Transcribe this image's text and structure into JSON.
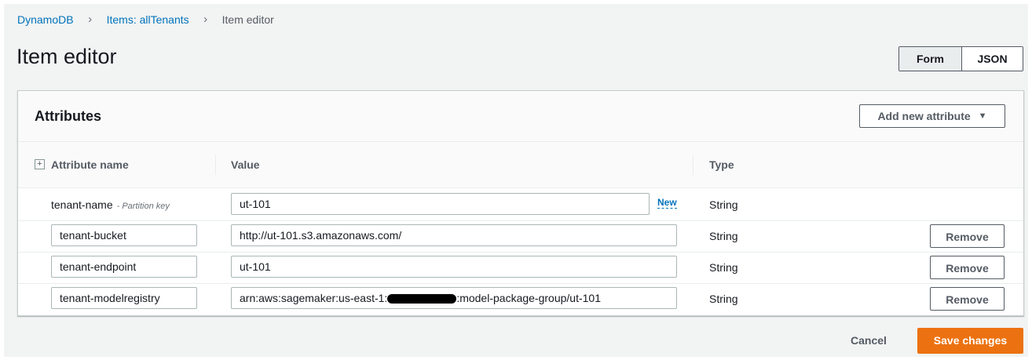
{
  "breadcrumb": {
    "items": [
      "DynamoDB",
      "Items: allTenants"
    ],
    "current": "Item editor",
    "separator": ">"
  },
  "page_title": "Item editor",
  "mode_toggle": {
    "form_label": "Form",
    "json_label": "JSON",
    "selected": "Form"
  },
  "panel": {
    "title": "Attributes",
    "add_button_label": "Add new attribute"
  },
  "columns": {
    "name": "Attribute name",
    "value": "Value",
    "type": "Type"
  },
  "rows": [
    {
      "name": "tenant-name",
      "key_label": "- Partition key",
      "value": "ut-101",
      "new_label": "New",
      "type": "String"
    },
    {
      "name": "tenant-bucket",
      "value": "http://ut-101.s3.amazonaws.com/",
      "type": "String",
      "remove_label": "Remove"
    },
    {
      "name": "tenant-endpoint",
      "value": "ut-101",
      "type": "String",
      "remove_label": "Remove"
    },
    {
      "name": "tenant-modelregistry",
      "value_prefix": "arn:aws:sagemaker:us-east-1:",
      "value_suffix": ":model-package-group/ut-101",
      "type": "String",
      "remove_label": "Remove"
    }
  ],
  "footer": {
    "cancel_label": "Cancel",
    "save_label": "Save changes"
  },
  "colors": {
    "link": "#0073bb",
    "primary": "#ec7211",
    "background": "#f2f3f3"
  },
  "icons": {
    "expand": "plus-square-icon",
    "dropdown": "caret-down-icon",
    "breadcrumb": "chevron-right-icon"
  }
}
